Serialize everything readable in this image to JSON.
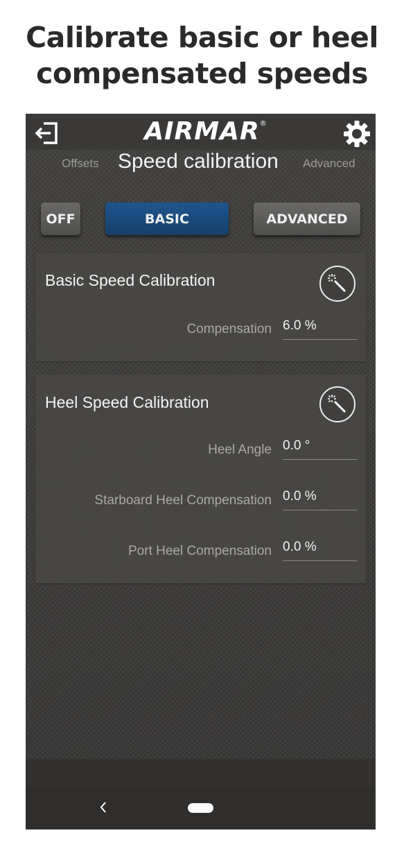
{
  "caption": {
    "line1": "Calibrate basic or heel",
    "line2": "compensated speeds"
  },
  "app": {
    "brand": "AIRMAR",
    "brand_mark": "®",
    "exit_icon": "exit-icon",
    "settings_icon": "gear-icon"
  },
  "nav": {
    "prev_label": "Offsets",
    "title": "Speed calibration",
    "next_label": "Advanced"
  },
  "modes": {
    "off_label": "OFF",
    "basic_label": "BASIC",
    "advanced_label": "ADVANCED",
    "selected": "BASIC",
    "selected_color": "#1c4f85"
  },
  "basic_calibration": {
    "title": "Basic Speed Calibration",
    "wand_icon": "magic-wand-icon",
    "compensation_label": "Compensation",
    "compensation_value": "6.0 %"
  },
  "heel_calibration": {
    "title": "Heel Speed Calibration",
    "wand_icon": "magic-wand-icon",
    "heel_angle_label": "Heel Angle",
    "heel_angle_value": "0.0 °",
    "starboard_label": "Starboard Heel Compensation",
    "starboard_value": "0.0 %",
    "port_label": "Port Heel Compensation",
    "port_value": "0.0 %"
  },
  "system_nav": {
    "back_icon": "back-chevron-icon",
    "home_icon": "home-pill-icon"
  }
}
